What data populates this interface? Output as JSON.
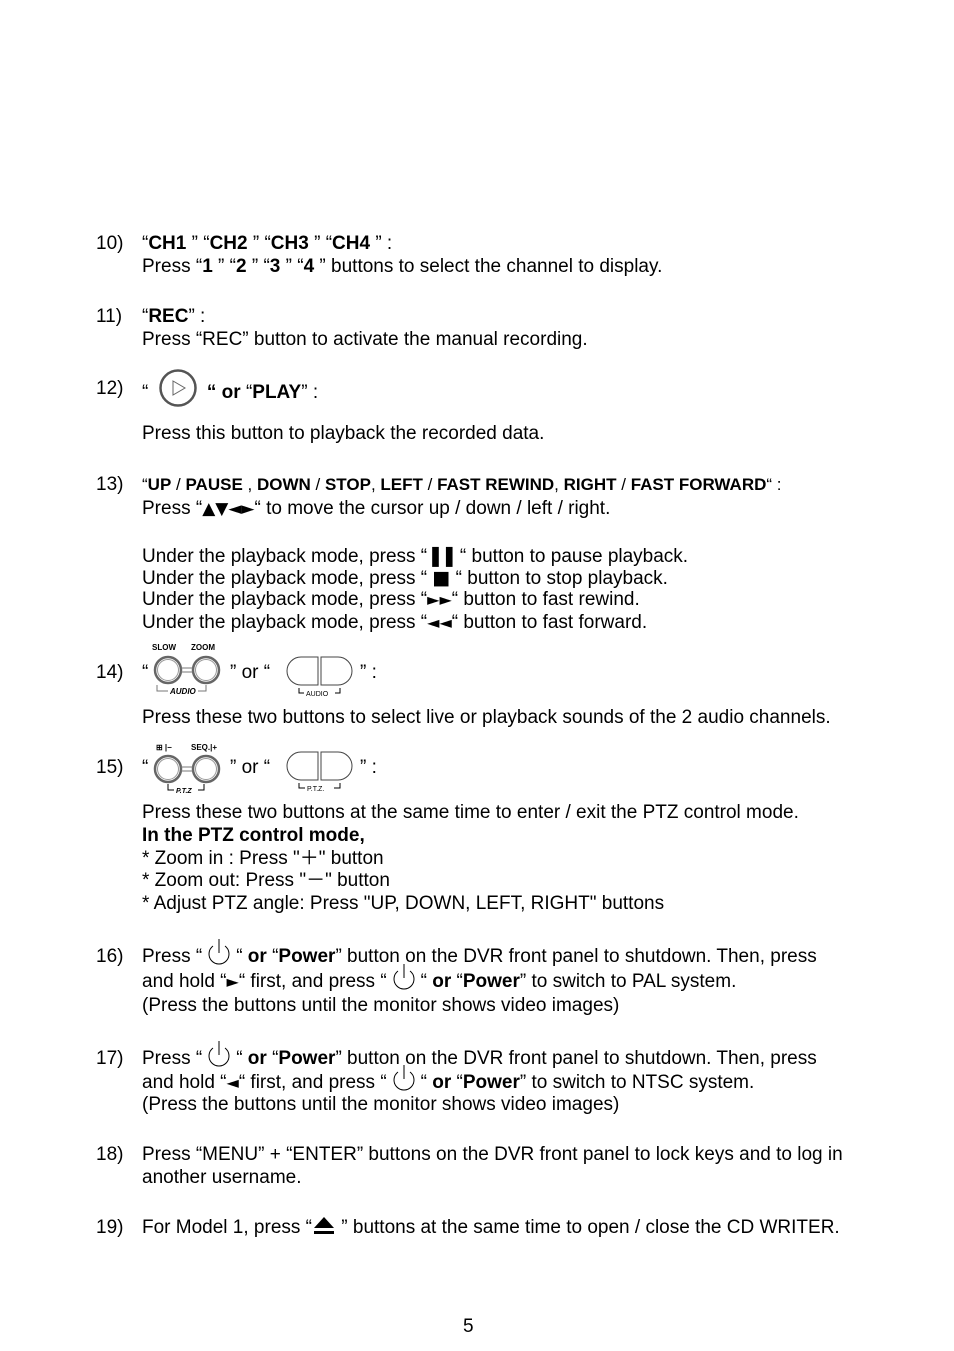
{
  "items": [
    {
      "number": "10)",
      "title_parts": [
        "“",
        "CH1",
        " ” “",
        "CH2",
        " ” “",
        "CH3",
        " ” “",
        "CH4",
        " ” :"
      ],
      "line2_parts": [
        "Press “",
        "1",
        " ” “",
        "2",
        " ” “",
        "3",
        " ” “",
        "4",
        " ” buttons to select the channel to display."
      ]
    },
    {
      "number": "11)",
      "title_parts": [
        "“",
        "REC",
        "” :"
      ],
      "line2": " Press “REC” button to activate the manual recording."
    },
    {
      "number": "12)",
      "quote_open": "“",
      "icon": "play-button-icon",
      "or": "“ or",
      "label_quote": "“",
      "label": "PLAY",
      "label_end": "” :",
      "line2": "Press this button to playback the recorded data."
    },
    {
      "number": "13)",
      "title_parts": [
        "“",
        "UP",
        " / ",
        "PAUSE",
        " , ",
        "DOWN",
        " / ",
        "STOP",
        ", ",
        "LEFT",
        " / ",
        "FAST REWIND",
        ", ",
        "RIGHT",
        " / ",
        "FAST FORWARD",
        "“ :"
      ],
      "line2_pre": "Press “",
      "line2_glyphs": "▲▼◄►",
      "line2_post": "“ to move the cursor up / down / left / right.",
      "playback_lines": [
        {
          "pre": "Under the playback mode, press “",
          "glyph": "❚❚",
          "icon": "pause-icon",
          "post": " “ button to pause playback."
        },
        {
          "pre": "Under the playback mode, press “ ",
          "glyph": "■",
          "icon": "stop-icon",
          "post": " “ button to stop playback."
        },
        {
          "pre": "Under the playback mode, press “",
          "glyph": "►►",
          "icon": "fast-forward-arrows-icon",
          "post": "“ button to fast rewind."
        },
        {
          "pre": "Under the playback mode, press “",
          "glyph": "◄◄",
          "icon": "rewind-arrows-icon",
          "post": "“ button to fast forward."
        }
      ]
    },
    {
      "number": "14)",
      "q_open": "“",
      "mid": "” or  “",
      "end": "” :",
      "knob_labels": [
        "SLOW",
        "ZOOM"
      ],
      "knob_caption": "AUDIO",
      "pill_caption": "AUDIO",
      "line2": "Press these two buttons to select live or playback sounds of the 2 audio channels."
    },
    {
      "number": "15)",
      "q_open": "“",
      "mid": "” or  “",
      "end": "” :",
      "knob_labels": [
        "⊞ |−",
        "SEQ.|+"
      ],
      "knob_caption": "P.T.Z",
      "pill_caption": "P.T.Z.",
      "line2": "Press these two buttons at the same time to enter / exit the PTZ control mode.",
      "line3": "In the PTZ control mode,",
      "bullets": [
        "* Zoom in : Press \"＋\" button",
        "* Zoom out: Press \"－\" button",
        "* Adjust PTZ angle: Press \"UP, DOWN, LEFT, RIGHT\" buttons"
      ]
    },
    {
      "number": "16)",
      "l1_pre": "Press “",
      "l1_mid": "“ ",
      "or": "or",
      "l1_q": "  “",
      "power": "Power",
      "l1_post": "” button on the DVR front panel to shutdown. Then, press",
      "l2_pre": "and hold “",
      "l2_glyph": "►",
      "l2_mid": "“ first, and press “",
      "l2_mid2": "“ ",
      "l2_post": "” to switch to PAL system.",
      "l3": "(Press the buttons until the monitor shows video images)"
    },
    {
      "number": "17)",
      "l1_pre": "Press “",
      "l1_mid": "“ ",
      "or": "or",
      "l1_q": "  “",
      "power": "Power",
      "l1_post": "” button on the DVR front panel to shutdown. Then, press",
      "l2_pre": "and hold “",
      "l2_glyph": "◄",
      "l2_mid": "“ first, and press “",
      "l2_mid2": "“ ",
      "l2_post": "” to switch to NTSC system.",
      "l3": "(Press the buttons until the monitor shows video images)"
    },
    {
      "number": "18)",
      "l1": "Press “MENU” + “ENTER” buttons on the DVR front panel to lock keys and to log in",
      "l2": "another username."
    },
    {
      "number": "19)",
      "pre": "For Model 1, press “",
      "post": " ” buttons at the same time to open / close the CD WRITER."
    }
  ],
  "page_number": "5"
}
